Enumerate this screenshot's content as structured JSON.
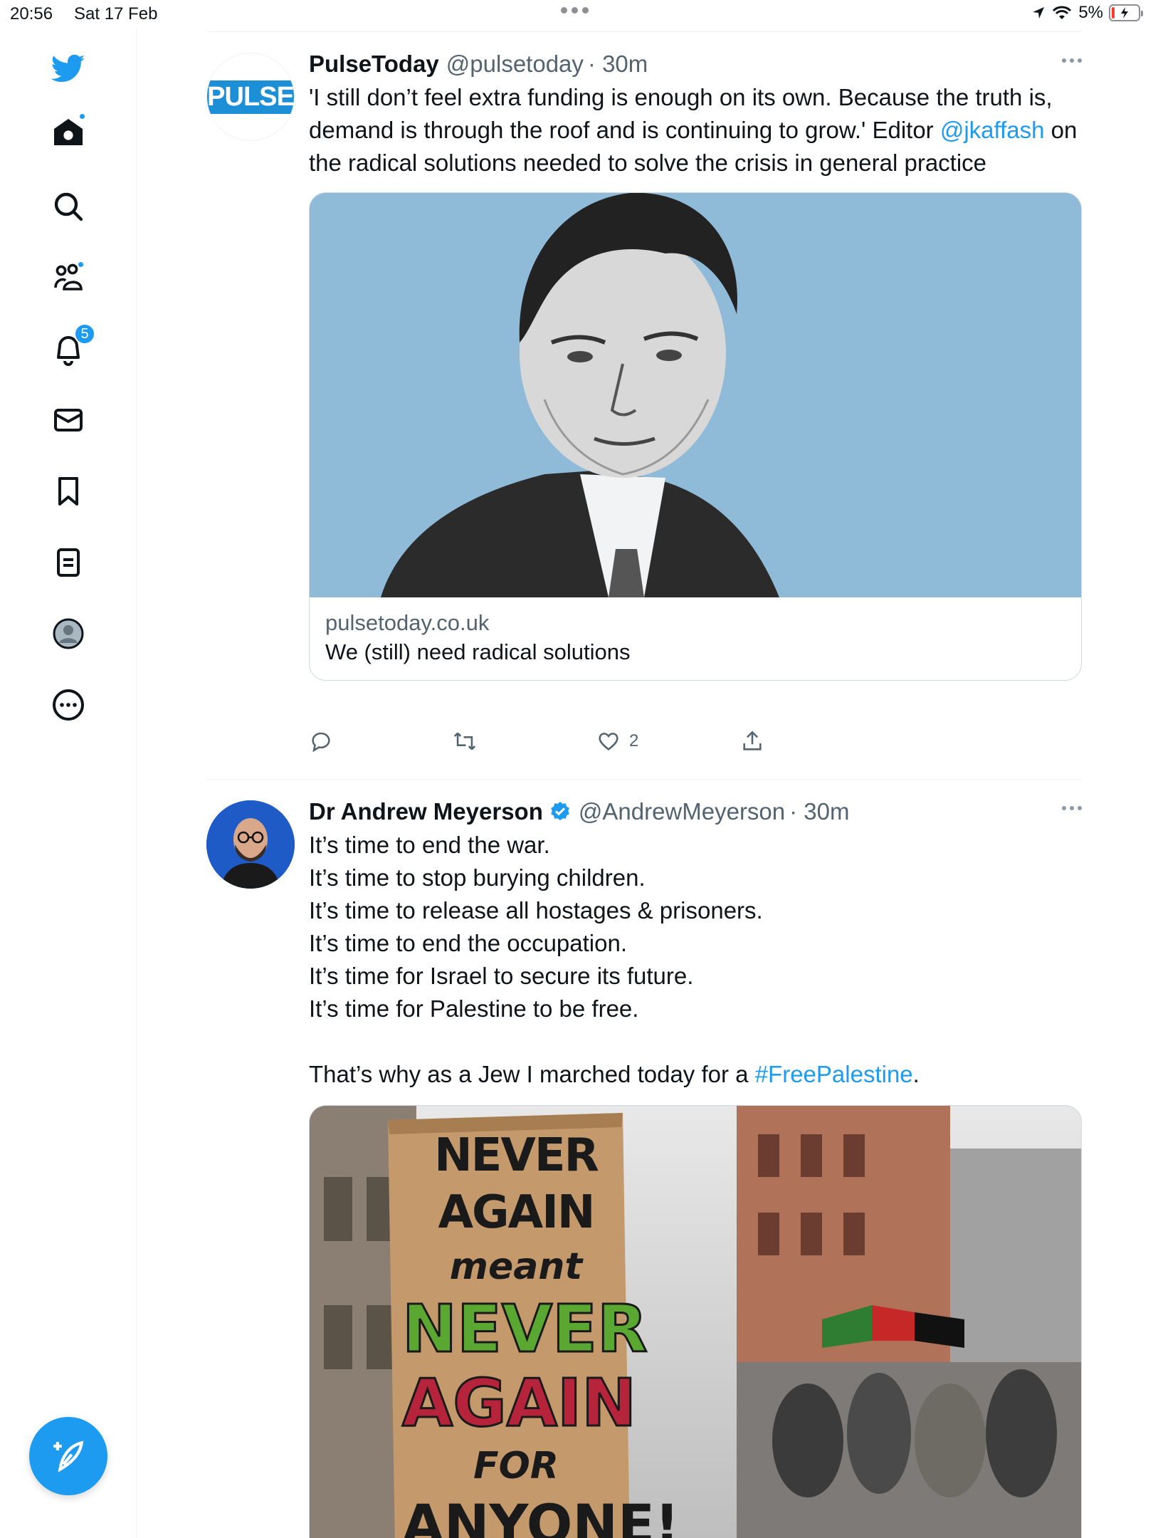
{
  "status_bar": {
    "time": "20:56",
    "date": "Sat 17 Feb",
    "battery": "5%"
  },
  "sidebar": {
    "items": [
      {
        "icon": "twitter-logo-icon"
      },
      {
        "icon": "home-icon",
        "has_dot": true
      },
      {
        "icon": "search-icon"
      },
      {
        "icon": "communities-icon",
        "has_dot": true
      },
      {
        "icon": "notifications-icon",
        "badge": "5"
      },
      {
        "icon": "messages-icon"
      },
      {
        "icon": "bookmarks-icon"
      },
      {
        "icon": "lists-icon"
      },
      {
        "icon": "profile-icon"
      },
      {
        "icon": "more-icon"
      }
    ],
    "notification_badge": "5",
    "compose_icon": "compose-tweet-icon"
  },
  "colors": {
    "accent": "#1d9bf0",
    "text": "#0f1419",
    "secondary_text": "#536471",
    "border": "#cfd9de"
  },
  "tweets": [
    {
      "name": "PulseToday",
      "handle": "@pulsetoday",
      "time": "· 30m",
      "avatar_text": "PULSE",
      "text_1": "'I still don’t feel extra funding is enough on its own. Because the truth is, demand is through the roof and is continuing to grow.' Editor ",
      "mention": "@jkaffash",
      "text_2": " on the radical solutions needed to solve the crisis in general practice",
      "card": {
        "domain": "pulsetoday.co.uk",
        "title": "We (still) need radical solutions"
      },
      "likes": "2"
    },
    {
      "name": "Dr Andrew Meyerson",
      "verified": true,
      "handle": "@AndrewMeyerson",
      "time": "· 30m",
      "text_1": "It’s time to end the war.\nIt’s time to stop burying children.\nIt’s time to release all hostages & prisoners.\nIt’s time to end the occupation.\nIt’s time for Israel to secure its future.\nIt’s time for Palestine to be free.\n\nThat’s why as a Jew I marched today for a ",
      "hashtag": "#FreePalestine",
      "text_2": ".",
      "sign": {
        "line1": "NEVER AGAIN",
        "line2": "meant",
        "line3": "NEVER",
        "line4": "AGAIN",
        "line5": "FOR",
        "line6": "ANYONE!"
      }
    }
  ]
}
